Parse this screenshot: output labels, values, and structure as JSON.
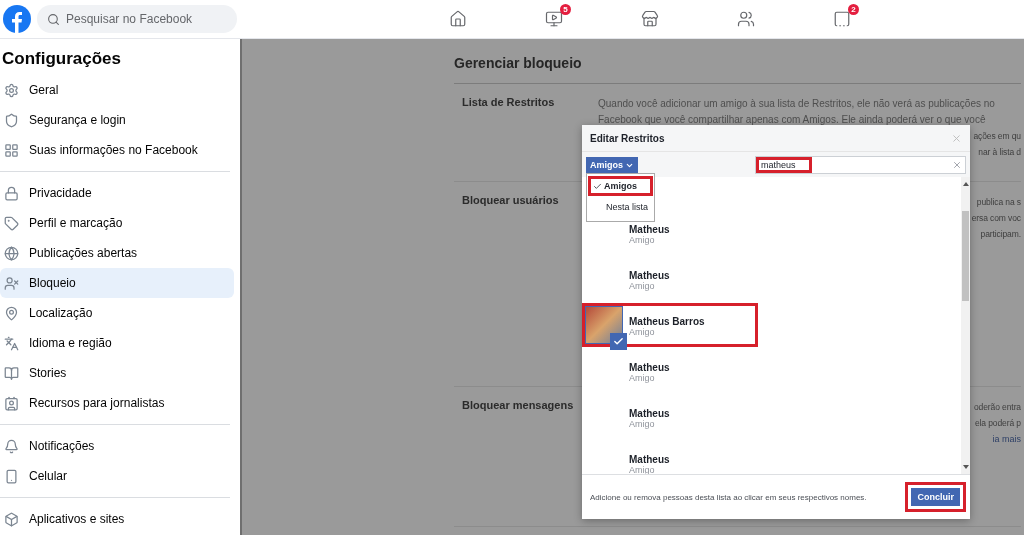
{
  "topbar": {
    "search": {
      "placeholder": "Pesquisar no Facebook"
    },
    "nav": [
      {
        "kind": "home"
      },
      {
        "kind": "video",
        "badge": "5"
      },
      {
        "kind": "store"
      },
      {
        "kind": "groups"
      },
      {
        "kind": "gaming",
        "badge": "2"
      }
    ]
  },
  "sidebar": {
    "title": "Configurações",
    "sections": [
      [
        {
          "label": "Geral",
          "selected": false
        },
        {
          "label": "Segurança e login",
          "selected": false
        },
        {
          "label": "Suas informações no Facebook",
          "selected": false
        }
      ],
      [
        {
          "label": "Privacidade",
          "selected": false
        },
        {
          "label": "Perfil e marcação",
          "selected": false
        },
        {
          "label": "Publicações abertas",
          "selected": false
        },
        {
          "label": "Bloqueio",
          "selected": true
        },
        {
          "label": "Localização",
          "selected": false
        },
        {
          "label": "Idioma e região",
          "selected": false
        },
        {
          "label": "Stories",
          "selected": false
        },
        {
          "label": "Recursos para jornalistas",
          "selected": false
        }
      ],
      [
        {
          "label": "Notificações",
          "selected": false
        },
        {
          "label": "Celular",
          "selected": false
        }
      ],
      [
        {
          "label": "Aplicativos e sites",
          "selected": false
        }
      ]
    ]
  },
  "main": {
    "title": "Gerenciar bloqueio",
    "rows": [
      {
        "label": "Lista de Restritos",
        "lines": [
          "Quando você adicionar um amigo à sua lista de Restritos, ele não verá as publicações no",
          "Facebook que você compartilhar apenas com Amigos. Ele ainda poderá ver o que você"
        ],
        "fragments": [
          "ações em qu",
          "nar à lista d"
        ],
        "link": null
      },
      {
        "label": "Bloquear usuários",
        "lines": [],
        "fragments": [
          "publica na s",
          "ersa com voc",
          "participam."
        ],
        "link": null
      },
      {
        "label": "Bloquear mensagens",
        "lines": [],
        "fragments": [
          "oderão entra",
          "ela poderá p"
        ],
        "link": "ia mais"
      }
    ]
  },
  "dialog": {
    "title": "Editar Restritos",
    "filter": {
      "label": "Amigos",
      "options": [
        {
          "label": "Amigos",
          "selected": true,
          "highlighted": true
        },
        {
          "label": "Nesta lista",
          "selected": false,
          "highlighted": false
        }
      ]
    },
    "search": {
      "value": "matheus",
      "highlighted": true
    },
    "people": [
      {
        "name": "Matheus",
        "subtitle": "Amigo",
        "selected": false,
        "highlighted": false
      },
      {
        "name": "Matheus",
        "subtitle": "Amigo",
        "selected": false,
        "highlighted": false
      },
      {
        "name": "Matheus Barros",
        "subtitle": "Amigo",
        "selected": true,
        "highlighted": true
      },
      {
        "name": "Matheus",
        "subtitle": "Amigo",
        "selected": false,
        "highlighted": false
      },
      {
        "name": "Matheus",
        "subtitle": "Amigo",
        "selected": false,
        "highlighted": false
      },
      {
        "name": "Matheus",
        "subtitle": "Amigo",
        "selected": false,
        "highlighted": false
      }
    ],
    "hint": "Adicione ou remova pessoas desta lista ao clicar em seus respectivos nomes.",
    "done": {
      "label": "Concluir",
      "highlighted": true
    }
  }
}
